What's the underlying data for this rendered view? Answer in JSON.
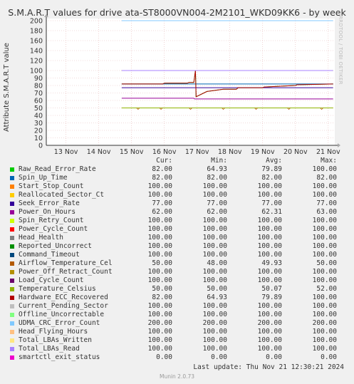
{
  "chart_data": {
    "type": "line",
    "title": "S.M.A.R.T values for drive ata-ST8000VN004-2M2101_WKD09KK6 - by week",
    "ylabel": "Attribute S.M.A.R.T value",
    "side_label": "RRDTOOL / TOBI OETIKER",
    "ylim": [
      0,
      200
    ],
    "yticks": [
      0,
      10,
      20,
      30,
      40,
      50,
      60,
      70,
      80,
      90,
      100,
      120,
      140,
      160,
      180,
      200
    ],
    "x_ticks": [
      "13 Nov",
      "14 Nov",
      "15 Nov",
      "16 Nov",
      "17 Nov",
      "18 Nov",
      "19 Nov",
      "20 Nov",
      "21 Nov"
    ],
    "x_range": [
      12.4,
      21.2
    ],
    "data_start": 14.7,
    "columns": [
      "Cur:",
      "Min:",
      "Avg:",
      "Max:"
    ],
    "series": [
      {
        "name": "Raw_Read_Error_Rate",
        "color": "#00cc00",
        "cur": "82.00",
        "min": "64.93",
        "avg": "79.89",
        "max": "100.00"
      },
      {
        "name": "Spin_Up_Time",
        "color": "#0066b3",
        "cur": "82.00",
        "min": "82.00",
        "avg": "82.00",
        "max": "82.00"
      },
      {
        "name": "Start_Stop_Count",
        "color": "#ff8000",
        "cur": "100.00",
        "min": "100.00",
        "avg": "100.00",
        "max": "100.00"
      },
      {
        "name": "Reallocated_Sector_Ct",
        "color": "#ffcc00",
        "cur": "100.00",
        "min": "100.00",
        "avg": "100.00",
        "max": "100.00"
      },
      {
        "name": "Seek_Error_Rate",
        "color": "#330099",
        "cur": "77.00",
        "min": "77.00",
        "avg": "77.00",
        "max": "77.00"
      },
      {
        "name": "Power_On_Hours",
        "color": "#990099",
        "cur": "62.00",
        "min": "62.00",
        "avg": "62.31",
        "max": "63.00"
      },
      {
        "name": "Spin_Retry_Count",
        "color": "#ccff00",
        "cur": "100.00",
        "min": "100.00",
        "avg": "100.00",
        "max": "100.00"
      },
      {
        "name": "Power_Cycle_Count",
        "color": "#ff0000",
        "cur": "100.00",
        "min": "100.00",
        "avg": "100.00",
        "max": "100.00"
      },
      {
        "name": "Head_Health",
        "color": "#808080",
        "cur": "100.00",
        "min": "100.00",
        "avg": "100.00",
        "max": "100.00"
      },
      {
        "name": "Reported_Uncorrect",
        "color": "#008f00",
        "cur": "100.00",
        "min": "100.00",
        "avg": "100.00",
        "max": "100.00"
      },
      {
        "name": "Command_Timeout",
        "color": "#00487d",
        "cur": "100.00",
        "min": "100.00",
        "avg": "100.00",
        "max": "100.00"
      },
      {
        "name": "Airflow_Temperature_Cel",
        "color": "#b35a00",
        "cur": "50.00",
        "min": "48.00",
        "avg": "49.93",
        "max": "50.00"
      },
      {
        "name": "Power_Off_Retract_Count",
        "color": "#b38f00",
        "cur": "100.00",
        "min": "100.00",
        "avg": "100.00",
        "max": "100.00"
      },
      {
        "name": "Load_Cycle_Count",
        "color": "#6b006b",
        "cur": "100.00",
        "min": "100.00",
        "avg": "100.00",
        "max": "100.00"
      },
      {
        "name": "Temperature_Celsius",
        "color": "#8fb300",
        "cur": "50.00",
        "min": "50.00",
        "avg": "50.07",
        "max": "52.00"
      },
      {
        "name": "Hardware_ECC_Recovered",
        "color": "#b30000",
        "cur": "82.00",
        "min": "64.93",
        "avg": "79.89",
        "max": "100.00"
      },
      {
        "name": "Current_Pending_Sector",
        "color": "#bebebe",
        "cur": "100.00",
        "min": "100.00",
        "avg": "100.00",
        "max": "100.00"
      },
      {
        "name": "Offline_Uncorrectable",
        "color": "#80ff80",
        "cur": "100.00",
        "min": "100.00",
        "avg": "100.00",
        "max": "100.00"
      },
      {
        "name": "UDMA_CRC_Error_Count",
        "color": "#80c9ff",
        "cur": "200.00",
        "min": "200.00",
        "avg": "200.00",
        "max": "200.00"
      },
      {
        "name": "Head_Flying_Hours",
        "color": "#ffc080",
        "cur": "100.00",
        "min": "100.00",
        "avg": "100.00",
        "max": "100.00"
      },
      {
        "name": "Total_LBAs_Written",
        "color": "#ffe680",
        "cur": "100.00",
        "min": "100.00",
        "avg": "100.00",
        "max": "100.00"
      },
      {
        "name": "Total_LBAs_Read",
        "color": "#aa80ff",
        "cur": "100.00",
        "min": "100.00",
        "avg": "100.00",
        "max": "100.00"
      },
      {
        "name": "smartctl_exit_status",
        "color": "#ee00cc",
        "cur": "0.00",
        "min": "0.00",
        "avg": "0.00",
        "max": "0.00"
      }
    ]
  },
  "footer": {
    "last_update": "Last update: Thu Nov 21 12:30:21 2024",
    "version": "Munin 2.0.73"
  }
}
